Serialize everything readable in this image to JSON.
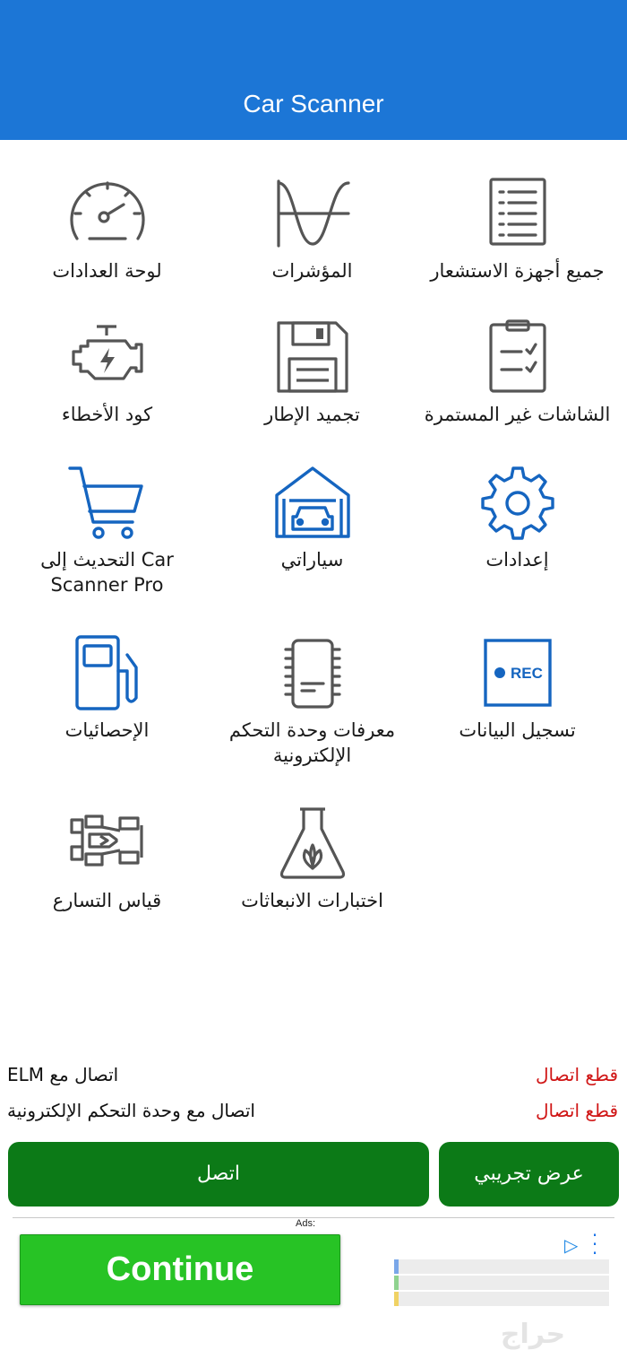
{
  "app": {
    "title": "Car Scanner"
  },
  "colors": {
    "header": "#1c76d6",
    "accent_icon": "#1565c0",
    "connect_button": "#0c7a17",
    "status_red": "#d01515",
    "ad_green": "#27c325"
  },
  "menu": [
    {
      "label": "لوحة العدادات",
      "icon": "speedometer-icon"
    },
    {
      "label": "المؤشرات",
      "icon": "waveform-icon"
    },
    {
      "label": "جميع أجهزة الاستشعار",
      "icon": "list-icon"
    },
    {
      "label": "كود الأخطاء",
      "icon": "engine-icon"
    },
    {
      "label": "تجميد الإطار",
      "icon": "floppy-disk-icon"
    },
    {
      "label": "الشاشات غير المستمرة",
      "icon": "clipboard-check-icon"
    },
    {
      "label": "التحديث إلى Car\nScanner Pro",
      "icon": "cart-icon"
    },
    {
      "label": "سياراتي",
      "icon": "garage-icon"
    },
    {
      "label": "إعدادات",
      "icon": "gear-icon"
    },
    {
      "label": "الإحصائيات",
      "icon": "fuel-pump-icon"
    },
    {
      "label": "معرفات وحدة التحكم\nالإلكترونية",
      "icon": "chip-icon"
    },
    {
      "label": "تسجيل البيانات",
      "icon": "rec-icon",
      "rec_text": "REC"
    },
    {
      "label": "قياس التسارع",
      "icon": "race-car-icon"
    },
    {
      "label": "اختبارات الانبعاثات",
      "icon": "flask-leaf-icon"
    }
  ],
  "status": {
    "elm": {
      "label": "اتصال مع ELM",
      "value": "قطع اتصال"
    },
    "ecu": {
      "label": "اتصال مع وحدة التحكم الإلكترونية",
      "value": "قطع اتصال"
    }
  },
  "buttons": {
    "connect": "اتصل",
    "demo": "عرض تجريبي"
  },
  "ad": {
    "tag": "Ads:",
    "cta": "Continue"
  },
  "watermark": "حراج"
}
